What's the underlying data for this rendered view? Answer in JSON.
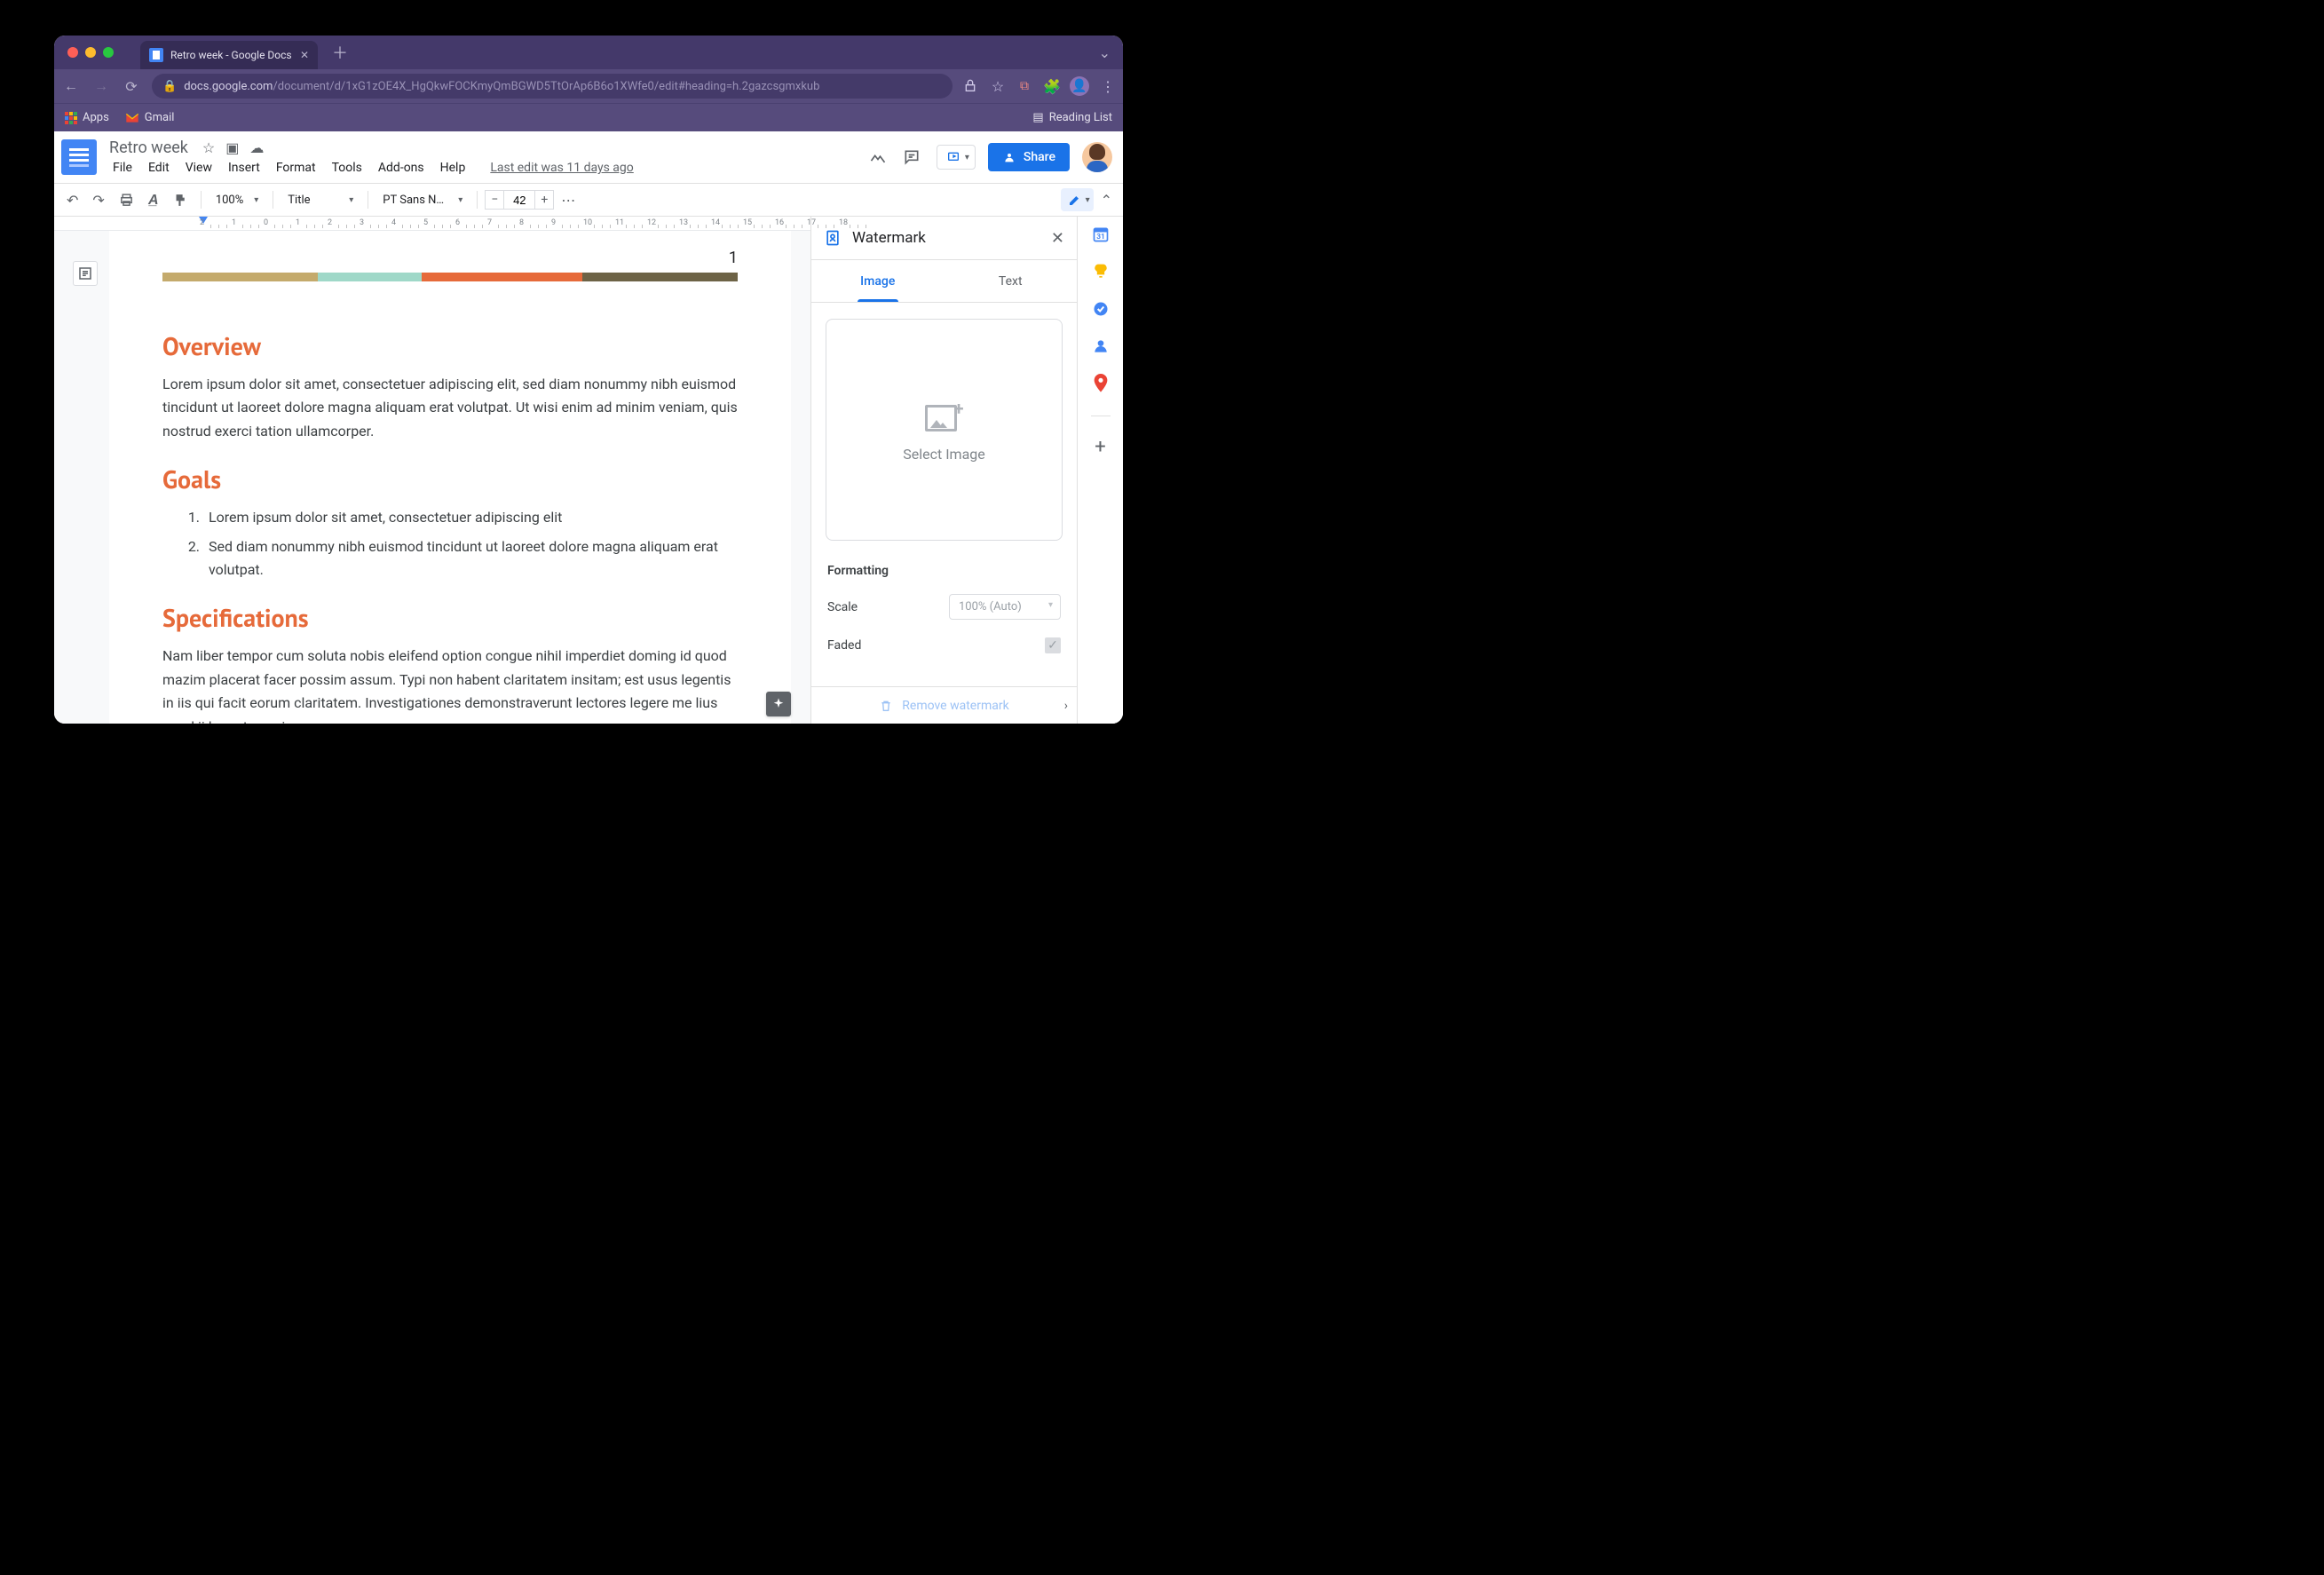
{
  "browser": {
    "tab_title": "Retro week - Google Docs",
    "url_host": "docs.google.com",
    "url_path": "/document/d/1xG1zOE4X_HgQkwFOCKmyQmBGWD5TtOrAp6B6o1XWfe0/edit#heading=h.2gazcsgmxkub",
    "bookmarks": {
      "apps": "Apps",
      "gmail": "Gmail",
      "reading_list": "Reading List"
    }
  },
  "docs": {
    "title": "Retro week",
    "last_edit": "Last edit was 11 days ago",
    "menu": [
      "File",
      "Edit",
      "View",
      "Insert",
      "Format",
      "Tools",
      "Add-ons",
      "Help"
    ],
    "share": "Share",
    "toolbar": {
      "zoom": "100%",
      "style": "Title",
      "font": "PT Sans N…",
      "font_size": "42"
    }
  },
  "document": {
    "page_number": "1",
    "sections": [
      {
        "heading": "Overview",
        "body": "Lorem ipsum dolor sit amet, consectetuer adipiscing elit, sed diam nonummy nibh euismod tincidunt ut laoreet dolore magna aliquam erat volutpat. Ut wisi enim ad minim veniam, quis nostrud exerci tation ullamcorper."
      },
      {
        "heading": "Goals",
        "list": [
          "Lorem ipsum dolor sit amet, consectetuer adipiscing elit",
          "Sed diam nonummy nibh euismod tincidunt ut laoreet dolore magna aliquam erat volutpat."
        ]
      },
      {
        "heading": "Specifications",
        "body": "Nam liber tempor cum soluta nobis eleifend option congue nihil imperdiet doming id quod mazim placerat facer possim assum. Typi non habent claritatem insitam; est usus legentis in iis qui facit eorum claritatem. Investigationes demonstraverunt lectores legere me lius quod ii legunt saepius."
      }
    ]
  },
  "watermark": {
    "title": "Watermark",
    "tabs": {
      "image": "Image",
      "text": "Text"
    },
    "select_image": "Select Image",
    "formatting_label": "Formatting",
    "scale_label": "Scale",
    "scale_value": "100% (Auto)",
    "faded_label": "Faded",
    "remove_label": "Remove watermark"
  }
}
